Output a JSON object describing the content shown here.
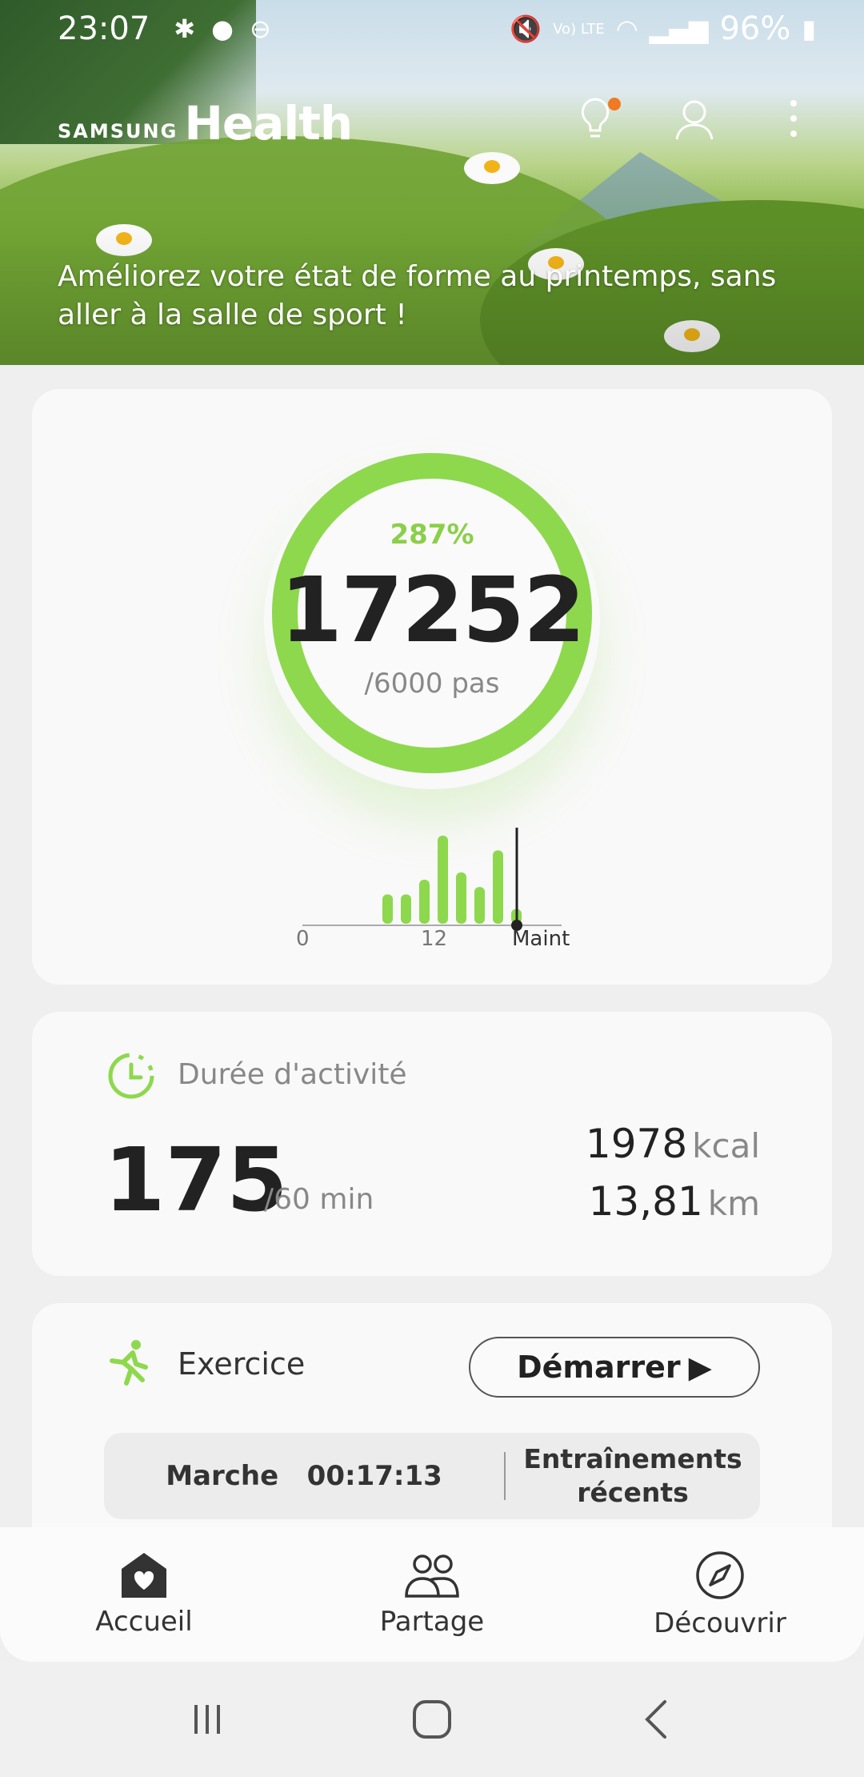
{
  "status_bar": {
    "time": "23:07",
    "battery": "96%",
    "net": "Vo) LTE"
  },
  "header": {
    "brand_prefix": "SAMSUNG",
    "brand_name": "Health",
    "banner_text": "Améliorez votre état de forme au printemps, sans aller à la salle de sport !"
  },
  "steps_card": {
    "percent": "287%",
    "count": "17252",
    "goal": "/6000 pas",
    "progress_fraction": 1.0,
    "chart_labels": [
      "0",
      "12",
      "Maint"
    ],
    "hourly_bars": [
      4,
      4,
      6,
      12,
      7,
      5,
      10,
      2
    ]
  },
  "activity_card": {
    "title": "Durée d'activité",
    "minutes": "175",
    "goal": "/60 min",
    "kcal_value": "1978",
    "kcal_unit": "kcal",
    "km_value": "13,81",
    "km_unit": "km"
  },
  "exercise_card": {
    "title": "Exercice",
    "start_label": "Démarrer",
    "last_activity": "Marche",
    "last_duration": "00:17:13",
    "recent_label": "Entraînements récents"
  },
  "bottom_nav": {
    "items": [
      {
        "label": "Accueil",
        "icon": "home-heart-icon"
      },
      {
        "label": "Partage",
        "icon": "people-icon"
      },
      {
        "label": "Découvrir",
        "icon": "compass-icon"
      }
    ]
  },
  "colors": {
    "accent": "#8ed84e",
    "badge": "#f07a22"
  }
}
